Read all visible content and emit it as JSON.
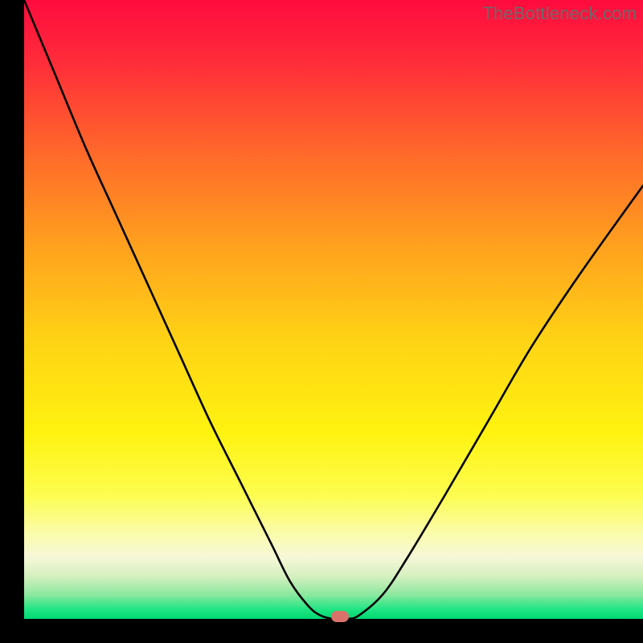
{
  "watermark": "TheBottleneck.com",
  "marker_color": "#d9736a",
  "chart_data": {
    "type": "line",
    "title": "",
    "xlabel": "",
    "ylabel": "",
    "xlim": [
      0,
      100
    ],
    "ylim": [
      0,
      100
    ],
    "series": [
      {
        "name": "bottleneck-curve",
        "x": [
          0,
          5,
          10,
          15,
          20,
          25,
          30,
          35,
          40,
          43,
          46,
          48,
          50,
          52,
          54,
          58,
          62,
          68,
          75,
          82,
          90,
          100
        ],
        "y": [
          100,
          88,
          76,
          65,
          54,
          43,
          32,
          22,
          12,
          6,
          2,
          0.5,
          0,
          0,
          0.5,
          4,
          10,
          20,
          32,
          44,
          56,
          70
        ]
      }
    ],
    "marker": {
      "x": 51,
      "y": 0
    },
    "gradient_stops": [
      {
        "pos": 0.0,
        "color": "#ff0b3e"
      },
      {
        "pos": 0.1,
        "color": "#ff2c3a"
      },
      {
        "pos": 0.25,
        "color": "#ff6a2a"
      },
      {
        "pos": 0.4,
        "color": "#ffa21e"
      },
      {
        "pos": 0.55,
        "color": "#ffd315"
      },
      {
        "pos": 0.7,
        "color": "#fff310"
      },
      {
        "pos": 0.8,
        "color": "#fdfd50"
      },
      {
        "pos": 0.86,
        "color": "#fbfca8"
      },
      {
        "pos": 0.9,
        "color": "#f6f8d8"
      },
      {
        "pos": 0.93,
        "color": "#d7f0c0"
      },
      {
        "pos": 0.96,
        "color": "#8fe8a0"
      },
      {
        "pos": 0.985,
        "color": "#1ee583"
      },
      {
        "pos": 1.0,
        "color": "#00d873"
      }
    ]
  }
}
